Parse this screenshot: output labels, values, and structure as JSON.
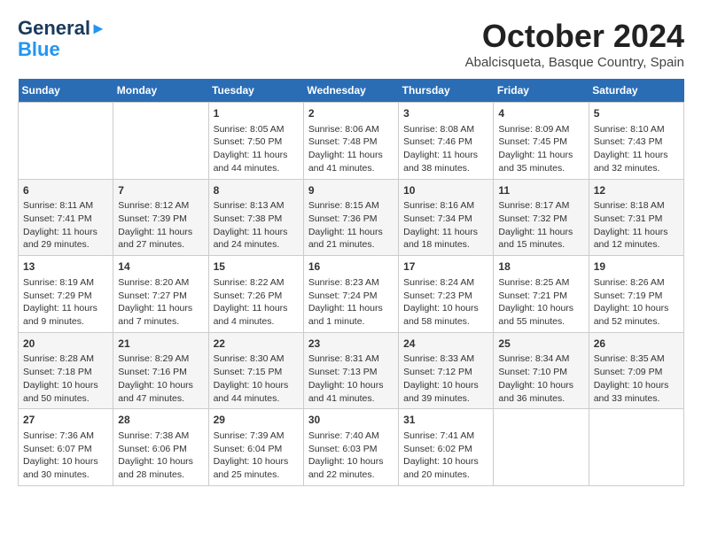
{
  "header": {
    "logo_line1": "General",
    "logo_line2": "Blue",
    "month": "October 2024",
    "location": "Abalcisqueta, Basque Country, Spain"
  },
  "weekdays": [
    "Sunday",
    "Monday",
    "Tuesday",
    "Wednesday",
    "Thursday",
    "Friday",
    "Saturday"
  ],
  "weeks": [
    [
      {
        "day": "",
        "content": ""
      },
      {
        "day": "",
        "content": ""
      },
      {
        "day": "1",
        "content": "Sunrise: 8:05 AM\nSunset: 7:50 PM\nDaylight: 11 hours and 44 minutes."
      },
      {
        "day": "2",
        "content": "Sunrise: 8:06 AM\nSunset: 7:48 PM\nDaylight: 11 hours and 41 minutes."
      },
      {
        "day": "3",
        "content": "Sunrise: 8:08 AM\nSunset: 7:46 PM\nDaylight: 11 hours and 38 minutes."
      },
      {
        "day": "4",
        "content": "Sunrise: 8:09 AM\nSunset: 7:45 PM\nDaylight: 11 hours and 35 minutes."
      },
      {
        "day": "5",
        "content": "Sunrise: 8:10 AM\nSunset: 7:43 PM\nDaylight: 11 hours and 32 minutes."
      }
    ],
    [
      {
        "day": "6",
        "content": "Sunrise: 8:11 AM\nSunset: 7:41 PM\nDaylight: 11 hours and 29 minutes."
      },
      {
        "day": "7",
        "content": "Sunrise: 8:12 AM\nSunset: 7:39 PM\nDaylight: 11 hours and 27 minutes."
      },
      {
        "day": "8",
        "content": "Sunrise: 8:13 AM\nSunset: 7:38 PM\nDaylight: 11 hours and 24 minutes."
      },
      {
        "day": "9",
        "content": "Sunrise: 8:15 AM\nSunset: 7:36 PM\nDaylight: 11 hours and 21 minutes."
      },
      {
        "day": "10",
        "content": "Sunrise: 8:16 AM\nSunset: 7:34 PM\nDaylight: 11 hours and 18 minutes."
      },
      {
        "day": "11",
        "content": "Sunrise: 8:17 AM\nSunset: 7:32 PM\nDaylight: 11 hours and 15 minutes."
      },
      {
        "day": "12",
        "content": "Sunrise: 8:18 AM\nSunset: 7:31 PM\nDaylight: 11 hours and 12 minutes."
      }
    ],
    [
      {
        "day": "13",
        "content": "Sunrise: 8:19 AM\nSunset: 7:29 PM\nDaylight: 11 hours and 9 minutes."
      },
      {
        "day": "14",
        "content": "Sunrise: 8:20 AM\nSunset: 7:27 PM\nDaylight: 11 hours and 7 minutes."
      },
      {
        "day": "15",
        "content": "Sunrise: 8:22 AM\nSunset: 7:26 PM\nDaylight: 11 hours and 4 minutes."
      },
      {
        "day": "16",
        "content": "Sunrise: 8:23 AM\nSunset: 7:24 PM\nDaylight: 11 hours and 1 minute."
      },
      {
        "day": "17",
        "content": "Sunrise: 8:24 AM\nSunset: 7:23 PM\nDaylight: 10 hours and 58 minutes."
      },
      {
        "day": "18",
        "content": "Sunrise: 8:25 AM\nSunset: 7:21 PM\nDaylight: 10 hours and 55 minutes."
      },
      {
        "day": "19",
        "content": "Sunrise: 8:26 AM\nSunset: 7:19 PM\nDaylight: 10 hours and 52 minutes."
      }
    ],
    [
      {
        "day": "20",
        "content": "Sunrise: 8:28 AM\nSunset: 7:18 PM\nDaylight: 10 hours and 50 minutes."
      },
      {
        "day": "21",
        "content": "Sunrise: 8:29 AM\nSunset: 7:16 PM\nDaylight: 10 hours and 47 minutes."
      },
      {
        "day": "22",
        "content": "Sunrise: 8:30 AM\nSunset: 7:15 PM\nDaylight: 10 hours and 44 minutes."
      },
      {
        "day": "23",
        "content": "Sunrise: 8:31 AM\nSunset: 7:13 PM\nDaylight: 10 hours and 41 minutes."
      },
      {
        "day": "24",
        "content": "Sunrise: 8:33 AM\nSunset: 7:12 PM\nDaylight: 10 hours and 39 minutes."
      },
      {
        "day": "25",
        "content": "Sunrise: 8:34 AM\nSunset: 7:10 PM\nDaylight: 10 hours and 36 minutes."
      },
      {
        "day": "26",
        "content": "Sunrise: 8:35 AM\nSunset: 7:09 PM\nDaylight: 10 hours and 33 minutes."
      }
    ],
    [
      {
        "day": "27",
        "content": "Sunrise: 7:36 AM\nSunset: 6:07 PM\nDaylight: 10 hours and 30 minutes."
      },
      {
        "day": "28",
        "content": "Sunrise: 7:38 AM\nSunset: 6:06 PM\nDaylight: 10 hours and 28 minutes."
      },
      {
        "day": "29",
        "content": "Sunrise: 7:39 AM\nSunset: 6:04 PM\nDaylight: 10 hours and 25 minutes."
      },
      {
        "day": "30",
        "content": "Sunrise: 7:40 AM\nSunset: 6:03 PM\nDaylight: 10 hours and 22 minutes."
      },
      {
        "day": "31",
        "content": "Sunrise: 7:41 AM\nSunset: 6:02 PM\nDaylight: 10 hours and 20 minutes."
      },
      {
        "day": "",
        "content": ""
      },
      {
        "day": "",
        "content": ""
      }
    ]
  ]
}
